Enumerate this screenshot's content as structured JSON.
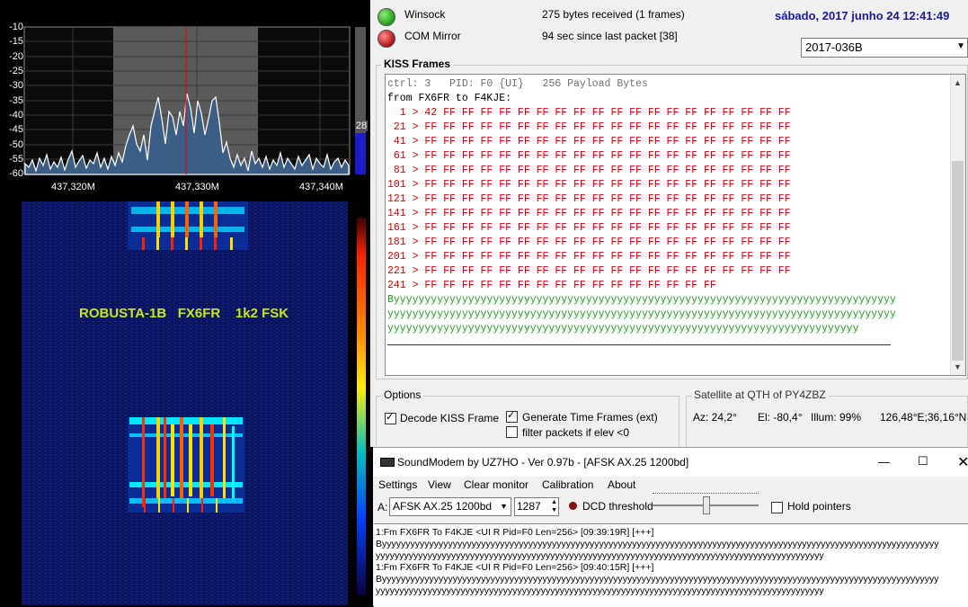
{
  "spectrum": {
    "y_ticks": [
      "-10",
      "-15",
      "-20",
      "-25",
      "-30",
      "-35",
      "-40",
      "-45",
      "-50",
      "-55",
      "-60"
    ],
    "x_labels": [
      "437,320M",
      "437,330M",
      "437,340M"
    ],
    "level_value": "28"
  },
  "waterfall": {
    "label": "ROBUSTA-1B   FX6FR    1k2 FSK"
  },
  "status": {
    "winsock_label": "Winsock",
    "winsock_info": "275 bytes received (1 frames)",
    "com_label": "COM Mirror",
    "com_info": "94 sec since last packet [38]",
    "datetime": "sábado, 2017 junho 24  12:41:49",
    "satellite_select": "2017-036B"
  },
  "kiss": {
    "title": "KISS Frames",
    "header": "ctrl: 3   PID: F0 {UI}   256 Payload Bytes",
    "from_line": "from FX6FR to F4KJE:",
    "hex_rows": [
      "  1 > 42 FF FF FF FF FF FF FF FF FF FF FF FF FF FF FF FF FF FF FF",
      " 21 > FF FF FF FF FF FF FF FF FF FF FF FF FF FF FF FF FF FF FF FF",
      " 41 > FF FF FF FF FF FF FF FF FF FF FF FF FF FF FF FF FF FF FF FF",
      " 61 > FF FF FF FF FF FF FF FF FF FF FF FF FF FF FF FF FF FF FF FF",
      " 81 > FF FF FF FF FF FF FF FF FF FF FF FF FF FF FF FF FF FF FF FF",
      "101 > FF FF FF FF FF FF FF FF FF FF FF FF FF FF FF FF FF FF FF FF",
      "121 > FF FF FF FF FF FF FF FF FF FF FF FF FF FF FF FF FF FF FF FF",
      "141 > FF FF FF FF FF FF FF FF FF FF FF FF FF FF FF FF FF FF FF FF",
      "161 > FF FF FF FF FF FF FF FF FF FF FF FF FF FF FF FF FF FF FF FF",
      "181 > FF FF FF FF FF FF FF FF FF FF FF FF FF FF FF FF FF FF FF FF",
      "201 > FF FF FF FF FF FF FF FF FF FF FF FF FF FF FF FF FF FF FF FF",
      "221 > FF FF FF FF FF FF FF FF FF FF FF FF FF FF FF FF FF FF FF FF",
      "241 > FF FF FF FF FF FF FF FF FF FF FF FF FF FF FF FF"
    ],
    "ascii_rows": [
      "Byyyyyyyyyyyyyyyyyyyyyyyyyyyyyyyyyyyyyyyyyyyyyyyyyyyyyyyyyyyyyyyyyyyyyyyyyyyyyyyyy",
      "yyyyyyyyyyyyyyyyyyyyyyyyyyyyyyyyyyyyyyyyyyyyyyyyyyyyyyyyyyyyyyyyyyyyyyyyyyyyyyyyyy",
      "yyyyyyyyyyyyyyyyyyyyyyyyyyyyyyyyyyyyyyyyyyyyyyyyyyyyyyyyyyyyyyyyyyyyyyyyyyyy"
    ]
  },
  "options": {
    "title": "Options",
    "decode_kiss": "Decode KISS Frame",
    "generate_time": "Generate Time Frames (ext)",
    "filter_packets": "filter packets if elev <0"
  },
  "satellite": {
    "title": "Satellite at QTH of PY4ZBZ",
    "az": "Az: 24,2°",
    "el": "El: -80,4°",
    "illum": "Illum: 99%",
    "coords": "126,48°E;36,16°N"
  },
  "soundmodem": {
    "title": "SoundModem by UZ7HO - Ver 0.97b - [AFSK AX.25 1200bd]",
    "menu": [
      "Settings",
      "View",
      "Clear monitor",
      "Calibration",
      "About"
    ],
    "channel_label": "A:",
    "modem_select": "AFSK AX.25 1200bd",
    "freq_value": "1287",
    "dcd_label": "DCD threshold",
    "hold_pointers": "Hold pointers",
    "log": [
      "1:Fm FX6FR To F4KJE <UI R Pid=F0 Len=256> [09:39:19R] [+++]",
      "Byyyyyyyyyyyyyyyyyyyyyyyyyyyyyyyyyyyyyyyyyyyyyyyyyyyyyyyyyyyyyyyyyyyyyyyyyyyyyyyyyyyyyyyyyyyyyyyyyyyyyyyyyyyyyyyyyyyyyy",
      "yyyyyyyyyyyyyyyyyyyyyyyyyyyyyyyyyyyyyyyyyyyyyyyyyyyyyyyyyyyyyyyyyyyyyyyyyyyyyyyyyyyyyyyyyyyyyyy",
      "1:Fm FX6FR To F4KJE <UI R Pid=F0 Len=256> [09:40:15R] [+++]",
      "Byyyyyyyyyyyyyyyyyyyyyyyyyyyyyyyyyyyyyyyyyyyyyyyyyyyyyyyyyyyyyyyyyyyyyyyyyyyyyyyyyyyyyyyyyyyyyyyyyyyyyyyyyyyyyyyyyyyyyy",
      "yyyyyyyyyyyyyyyyyyyyyyyyyyyyyyyyyyyyyyyyyyyyyyyyyyyyyyyyyyyyyyyyyyyyyyyyyyyyyyyyyyyyyyyyyyyyyyy"
    ]
  }
}
